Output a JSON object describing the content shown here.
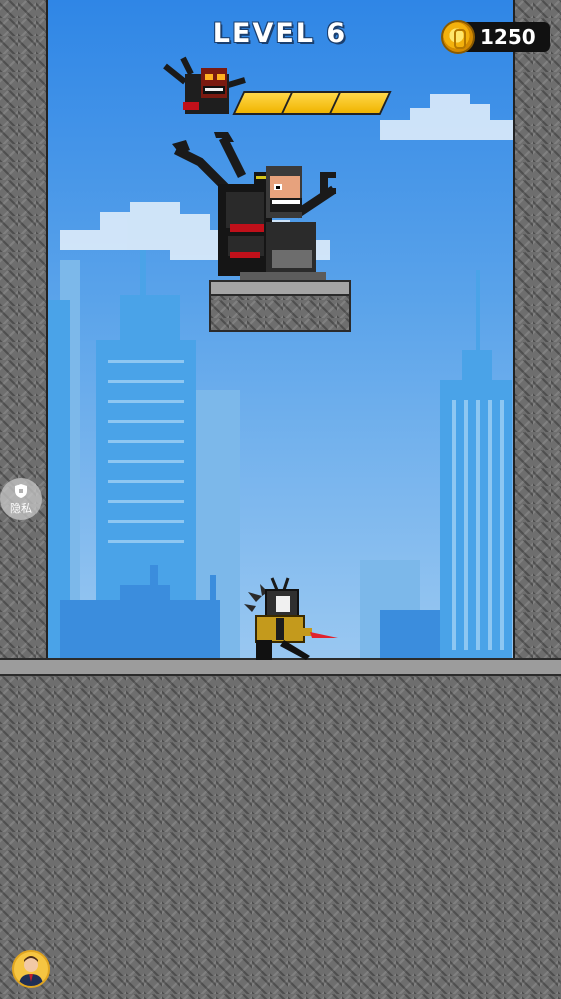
{
  "hud": {
    "level_label": "LEVEL 6",
    "coins": "1250",
    "boss_health_segments_filled": 3,
    "boss_health_segments_total": 3
  },
  "side_button": {
    "label": "隐私",
    "icon": "shield-icon"
  },
  "colors": {
    "sky_top": "#2f86e6",
    "sky_bottom": "#c9e2f7",
    "health_bar": "#f0b400",
    "coin": "#f3b10d",
    "brick": "#6e6e6e"
  },
  "characters": {
    "boss": "mechanical-speakerman-boss",
    "player": "tv-head-agent-with-blade"
  }
}
